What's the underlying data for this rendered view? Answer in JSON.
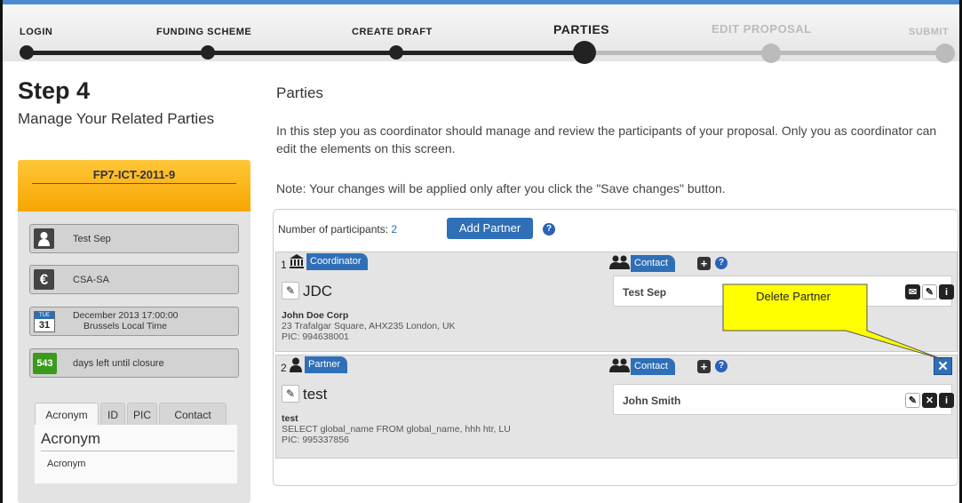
{
  "wizard": {
    "steps": [
      {
        "label": "LOGIN",
        "state": "done"
      },
      {
        "label": "FUNDING SCHEME",
        "state": "done"
      },
      {
        "label": "CREATE DRAFT",
        "state": "done"
      },
      {
        "label": "PARTIES",
        "state": "current"
      },
      {
        "label": "EDIT PROPOSAL",
        "state": "todo"
      },
      {
        "label": "SUBMIT",
        "state": "todo"
      }
    ]
  },
  "sidebar": {
    "step_title": "Step 4",
    "step_subtitle": "Manage Your Related Parties",
    "call_id": "FP7-ICT-2011-9",
    "user": "Test Sep",
    "scheme": "CSA-SA",
    "deadline": {
      "weekday": "TUE",
      "day": "31",
      "line1": "December 2013 17:00:00",
      "line2": "Brussels Local Time"
    },
    "days_left": {
      "count": "543",
      "label": "days left until closure"
    },
    "tabs": [
      "Acronym",
      "ID",
      "PIC",
      "Contact"
    ],
    "active_tab_heading": "Acronym",
    "active_tab_item": "Acronym"
  },
  "main": {
    "title": "Parties",
    "intro": "In this step you as coordinator should manage and review the participants of your proposal. Only you as coordinator can edit the elements on this screen.",
    "note": "Note: Your changes will be applied only after you click the \"Save changes\" button.",
    "participants_label": "Number of participants:",
    "participants_count": "2",
    "add_partner_label": "Add Partner",
    "help_glyph": "?",
    "contact_label": "Contact",
    "tooltip": "Delete Partner",
    "parties": [
      {
        "number": "1",
        "role": "Coordinator",
        "short_name": "JDC",
        "legal_name": "John Doe Corp",
        "address": "23 Trafalgar Square, AHX235 London, UK",
        "pic": "PIC: 994638001",
        "contact": "Test Sep"
      },
      {
        "number": "2",
        "role": "Partner",
        "short_name": "test",
        "legal_name": "test",
        "address": "SELECT global_name FROM global_name, hhh htr, LU",
        "pic": "PIC: 995337856",
        "contact": "John Smith"
      }
    ]
  },
  "colors": {
    "accent": "#2f6fb7",
    "call_header": "#f6a600",
    "days_badge": "#3a9a1a",
    "tooltip": "#ffff00"
  }
}
